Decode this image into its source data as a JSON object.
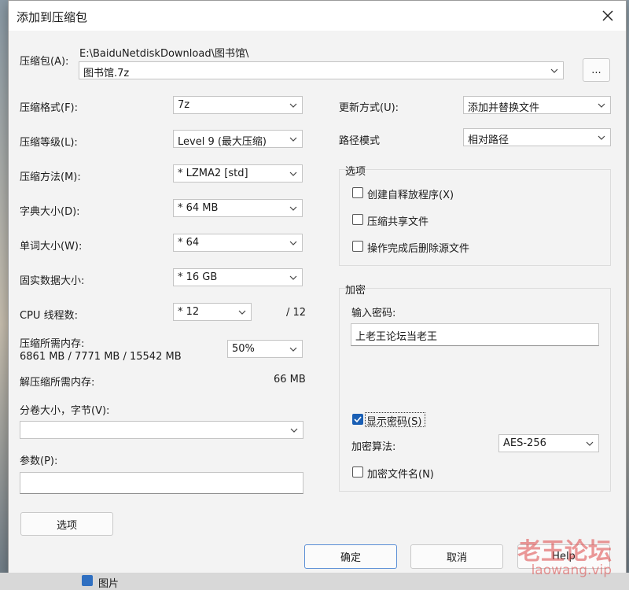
{
  "window": {
    "title": "添加到压缩包"
  },
  "archive": {
    "label": "压缩包(A):",
    "path": "E:\\BaiduNetdiskDownload\\图书馆\\",
    "name": "图书馆.7z",
    "browse_label": "..."
  },
  "left": {
    "format": {
      "label": "压缩格式(F):",
      "value": "7z"
    },
    "level": {
      "label": "压缩等级(L):",
      "value": "Level 9 (最大压缩)"
    },
    "method": {
      "label": "压缩方法(M):",
      "value": "*  LZMA2 [std]"
    },
    "dict": {
      "label": "字典大小(D):",
      "value": "*  64 MB"
    },
    "word": {
      "label": "单词大小(W):",
      "value": "*  64"
    },
    "solid": {
      "label": "固实数据大小:",
      "value": "*  16 GB"
    },
    "cpu": {
      "label": "CPU 线程数:",
      "value": "*  12",
      "max": "/ 12"
    },
    "mem": {
      "label": "压缩所需内存:",
      "detail": "6861 MB / 7771 MB / 15542 MB",
      "value": "50%"
    },
    "decomp": {
      "label": "解压缩所需内存:",
      "value": "66 MB"
    },
    "volume": {
      "label": "分卷大小，字节(V):",
      "value": ""
    },
    "params": {
      "label": "参数(P):",
      "value": ""
    },
    "options_button": "选项"
  },
  "right": {
    "update": {
      "label": "更新方式(U):",
      "value": "添加并替换文件"
    },
    "pathmode": {
      "label": "路径模式",
      "value": "相对路径"
    },
    "options": {
      "title": "选项",
      "sfx": "创建自释放程序(X)",
      "shared": "压缩共享文件",
      "delete": "操作完成后删除源文件"
    },
    "encryption": {
      "title": "加密",
      "password_label": "输入密码:",
      "password": "上老王论坛当老王",
      "show_password": "显示密码(S)",
      "algo_label": "加密算法:",
      "algo": "AES-256",
      "encrypt_names": "加密文件名(N)"
    }
  },
  "buttons": {
    "ok": "确定",
    "cancel": "取消",
    "help": "Help"
  },
  "taskbar": {
    "item": "图片"
  },
  "watermark": {
    "line1": "老王论坛",
    "line2": "laowang.vip"
  }
}
